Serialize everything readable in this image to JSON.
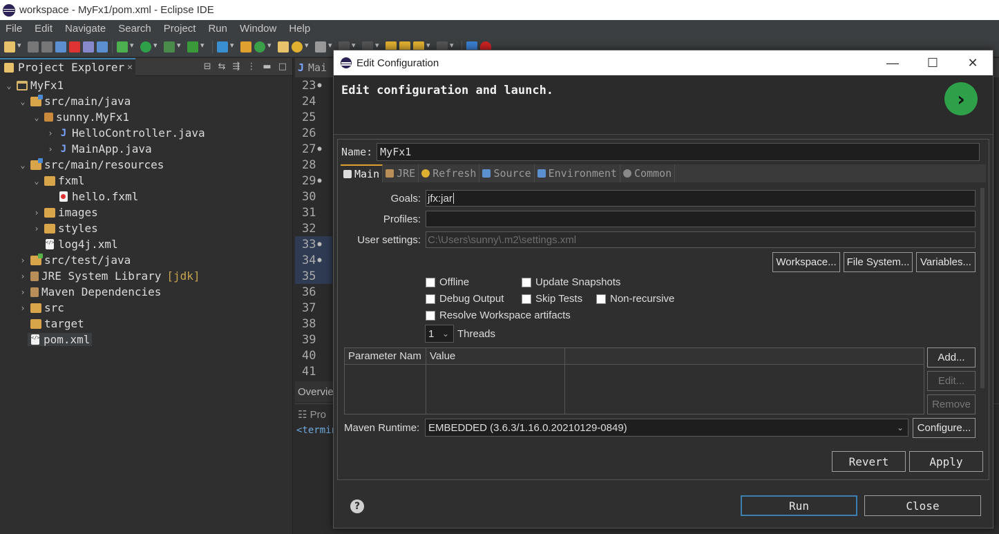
{
  "window": {
    "title": "workspace - MyFx1/pom.xml - Eclipse IDE"
  },
  "menu": [
    "File",
    "Edit",
    "Navigate",
    "Search",
    "Project",
    "Run",
    "Window",
    "Help"
  ],
  "explorer": {
    "tab_label": "Project Explorer",
    "tree": [
      {
        "label": "MyFx1",
        "decoration": ""
      },
      {
        "label": "src/main/java",
        "decoration": ""
      },
      {
        "label": "sunny.MyFx1",
        "decoration": ""
      },
      {
        "label": "HelloController.java",
        "decoration": ""
      },
      {
        "label": "MainApp.java",
        "decoration": ""
      },
      {
        "label": "src/main/resources",
        "decoration": ""
      },
      {
        "label": "fxml",
        "decoration": ""
      },
      {
        "label": "hello.fxml",
        "decoration": ""
      },
      {
        "label": "images",
        "decoration": ""
      },
      {
        "label": "styles",
        "decoration": ""
      },
      {
        "label": "log4j.xml",
        "decoration": ""
      },
      {
        "label": "src/test/java",
        "decoration": ""
      },
      {
        "label": "JRE System Library",
        "decoration": "[jdk]"
      },
      {
        "label": "Maven Dependencies",
        "decoration": ""
      },
      {
        "label": "src",
        "decoration": ""
      },
      {
        "label": "target",
        "decoration": ""
      },
      {
        "label": "pom.xml",
        "decoration": ""
      }
    ]
  },
  "editor": {
    "tab_label": "Mai",
    "line_numbers": [
      "23",
      "24",
      "25",
      "26",
      "27",
      "28",
      "29",
      "30",
      "31",
      "32",
      "33",
      "34",
      "35",
      "36",
      "37",
      "38",
      "39",
      "40",
      "41"
    ],
    "overview_tab": "Overvie",
    "console_tab": "Pro",
    "console_line": "<termin"
  },
  "dialog": {
    "title": "Edit Configuration",
    "heading": "Edit configuration and launch.",
    "name_label": "Name:",
    "name_value": "MyFx1",
    "tabs": [
      "Main",
      "JRE",
      "Refresh",
      "Source",
      "Environment",
      "Common"
    ],
    "goals_label": "Goals:",
    "goals_value": "jfx:jar",
    "profiles_label": "Profiles:",
    "profiles_value": "",
    "user_settings_label": "User settings:",
    "user_settings_value": "C:\\Users\\sunny\\.m2\\settings.xml",
    "btn_workspace": "Workspace...",
    "btn_filesystem": "File System...",
    "btn_variables": "Variables...",
    "chk_offline": "Offline",
    "chk_update_snapshots": "Update Snapshots",
    "chk_debug_output": "Debug Output",
    "chk_skip_tests": "Skip Tests",
    "chk_non_recursive": "Non-recursive",
    "chk_resolve_workspace": "Resolve Workspace artifacts",
    "threads_value": "1",
    "threads_label": "Threads",
    "param_col1": "Parameter Nam",
    "param_col2": "Value",
    "btn_add": "Add...",
    "btn_edit": "Edit...",
    "btn_remove": "Remove",
    "runtime_label": "Maven Runtime:",
    "runtime_value": "EMBEDDED (3.6.3/1.16.0.20210129-0849)",
    "btn_configure": "Configure...",
    "btn_revert": "Revert",
    "btn_apply": "Apply",
    "btn_run": "Run",
    "btn_close": "Close"
  },
  "colors": {
    "accent": "#3c7fb1",
    "run_badge": "#2fa04a",
    "active_tab": "#e0a030"
  }
}
